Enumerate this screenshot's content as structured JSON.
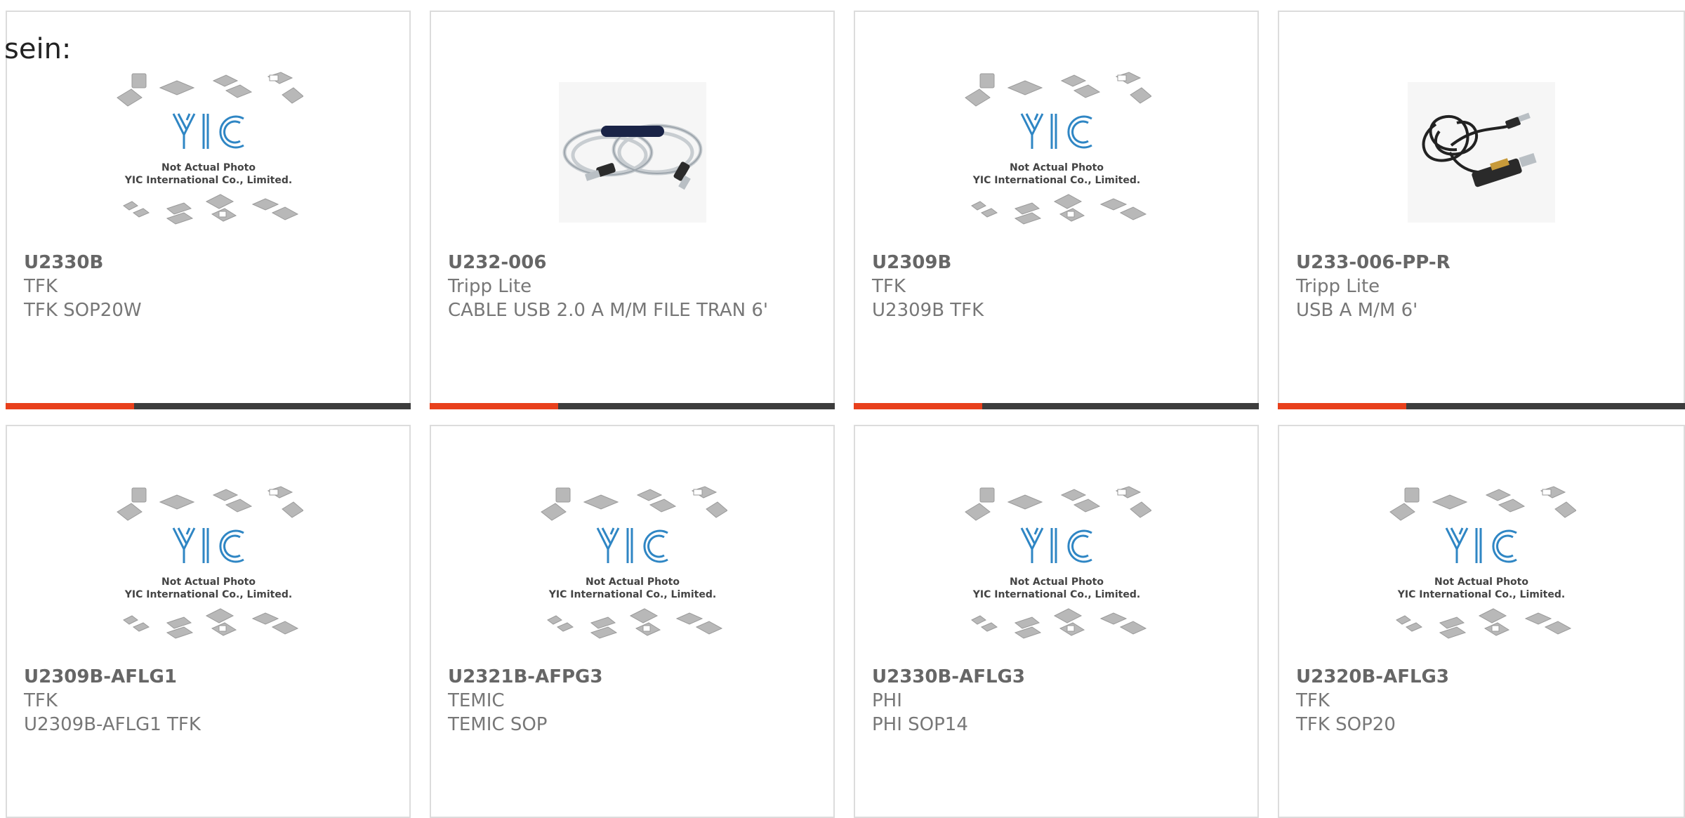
{
  "page": {
    "prefix_text": "sein:"
  },
  "colors": {
    "accent_orange": "#e8401c",
    "bar_dark": "#3d3d3d",
    "yic_blue": "#2f86c4",
    "text_gray": "#777777"
  },
  "placeholder": {
    "line1": "Not Actual Photo",
    "line2": "YIC International Co., Limited."
  },
  "products": [
    {
      "part": "U2330B",
      "maker": "TFK",
      "desc": "TFK SOP20W",
      "image": "yic-placeholder"
    },
    {
      "part": "U232-006",
      "maker": "Tripp Lite",
      "desc": "CABLE USB 2.0 A M/M FILE TRAN 6'",
      "image": "usb-cable-clear"
    },
    {
      "part": "U2309B",
      "maker": "TFK",
      "desc": "U2309B TFK",
      "image": "yic-placeholder"
    },
    {
      "part": "U233-006-PP-R",
      "maker": "Tripp Lite",
      "desc": "USB A M/M 6'",
      "image": "usb-cable-black"
    },
    {
      "part": "U2309B-AFLG1",
      "maker": "TFK",
      "desc": "U2309B-AFLG1 TFK",
      "image": "yic-placeholder"
    },
    {
      "part": "U2321B-AFPG3",
      "maker": "TEMIC",
      "desc": "TEMIC SOP",
      "image": "yic-placeholder"
    },
    {
      "part": "U2330B-AFLG3",
      "maker": "PHI",
      "desc": "PHI SOP14",
      "image": "yic-placeholder"
    },
    {
      "part": "U2320B-AFLG3",
      "maker": "TFK",
      "desc": "TFK SOP20",
      "image": "yic-placeholder"
    }
  ]
}
